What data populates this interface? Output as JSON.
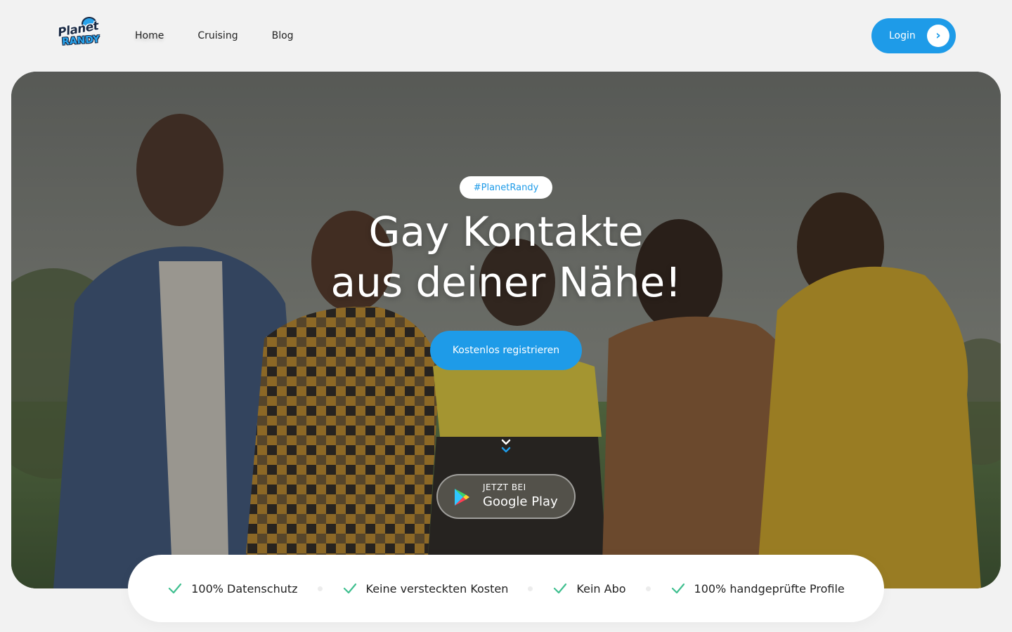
{
  "header": {
    "logo": {
      "line1": "Planet",
      "line2": "RANDY"
    },
    "nav": [
      {
        "label": "Home",
        "active": true
      },
      {
        "label": "Cruising",
        "active": false
      },
      {
        "label": "Blog",
        "active": false
      }
    ],
    "login_label": "Login",
    "login_icon": "chevron-right-icon"
  },
  "hero": {
    "tag": "#PlanetRandy",
    "headline_line1": "Gay Kontakte",
    "headline_line2": "aus deiner Nähe!",
    "register_label": "Kostenlos registrieren",
    "scroll_icon": "double-chevron-down-icon",
    "store_button": {
      "small": "JETZT BEI",
      "big": "Google Play",
      "icon": "google-play-icon"
    }
  },
  "features": [
    {
      "label": "100% Datenschutz",
      "icon": "check-icon"
    },
    {
      "label": "Keine versteckten Kosten",
      "icon": "check-icon"
    },
    {
      "label": "Kein Abo",
      "icon": "check-icon"
    },
    {
      "label": "100% handgeprüfte Profile",
      "icon": "check-icon"
    }
  ],
  "colors": {
    "accent": "#1e9be8",
    "check": "#3fbf8f",
    "page_bg": "#f2f2f2"
  }
}
